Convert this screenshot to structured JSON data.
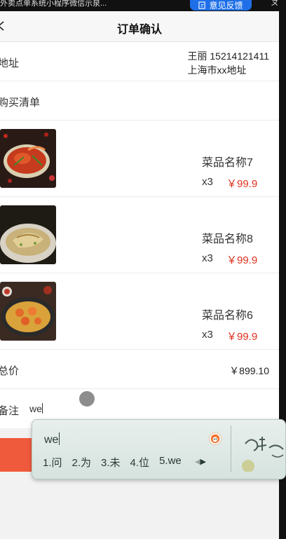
{
  "window": {
    "title": "外卖点单系统小程序微信示泉...",
    "feedback_label": "意见反馈",
    "pin_glyph": "ㄆ"
  },
  "navbar": {
    "title": "订单确认"
  },
  "address": {
    "label": "地址",
    "contact": "王丽 15214121411",
    "detail": "上海市xx地址"
  },
  "list": {
    "label": "购买清单",
    "items": [
      {
        "name": "菜品名称7",
        "qty": "x3",
        "price": "￥99.9"
      },
      {
        "name": "菜品名称8",
        "qty": "x3",
        "price": "￥99.9"
      },
      {
        "name": "菜品名称6",
        "qty": "x3",
        "price": "￥99.9"
      }
    ]
  },
  "total": {
    "label": "总价",
    "value": "￥899.10"
  },
  "remark": {
    "label": "备注",
    "value": "we"
  },
  "ime": {
    "composition": "we",
    "candidates": [
      "1.问",
      "2.为",
      "3.未",
      "4.位",
      "5.we"
    ]
  },
  "colors": {
    "accent": "#f05a3c",
    "price": "#e0301e",
    "feedback": "#1e6fe8"
  }
}
